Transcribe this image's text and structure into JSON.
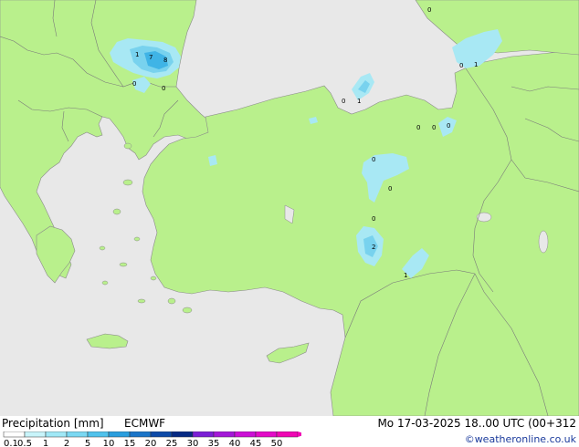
{
  "footer": {
    "title": "Precipitation [mm]",
    "model": "ECMWF",
    "valid_time": "Mo 17-03-2025 18..00 UTC (00+312",
    "credit": "©weatheronline.co.uk"
  },
  "colors": {
    "sea": "#e8e8e8",
    "land": "#b9f08c",
    "border": "#7a7a7a",
    "precip_light": "#a8e8f4",
    "precip_mid": "#78d2ee",
    "precip_heavy": "#3fb4e6"
  },
  "legend": {
    "labels": [
      "0.1",
      "0.5",
      "1",
      "2",
      "5",
      "10",
      "15",
      "20",
      "25",
      "30",
      "35",
      "40",
      "45",
      "50"
    ],
    "colors": [
      "#ffffff",
      "#c8f4fa",
      "#a0e8f6",
      "#7ad8f2",
      "#50c2ec",
      "#2a9ede",
      "#1a74c8",
      "#0c4aa8",
      "#062a84",
      "#7b1fd6",
      "#a418d8",
      "#cc10d6",
      "#e40ac8",
      "#f006b4"
    ]
  },
  "precip_labels": [
    {
      "id": "bg-1",
      "text": "1"
    },
    {
      "id": "bg-7",
      "text": "7"
    },
    {
      "id": "bg-8",
      "text": "8"
    },
    {
      "id": "bg-0a",
      "text": "0"
    },
    {
      "id": "bg-0b",
      "text": "0"
    },
    {
      "id": "bs-0",
      "text": "0"
    },
    {
      "id": "bs-1",
      "text": "1"
    },
    {
      "id": "ge-0a",
      "text": "0"
    },
    {
      "id": "ge-0b",
      "text": "0"
    },
    {
      "id": "ge-1",
      "text": "1"
    },
    {
      "id": "tr-ne-0a",
      "text": "0"
    },
    {
      "id": "tr-ne-0b",
      "text": "0"
    },
    {
      "id": "tr-ne-0c",
      "text": "0"
    },
    {
      "id": "tr-c-0a",
      "text": "0"
    },
    {
      "id": "tr-c-0b",
      "text": "0"
    },
    {
      "id": "tr-c-0c",
      "text": "0"
    },
    {
      "id": "tr-s-2",
      "text": "2"
    },
    {
      "id": "tr-se-1",
      "text": "1"
    }
  ]
}
